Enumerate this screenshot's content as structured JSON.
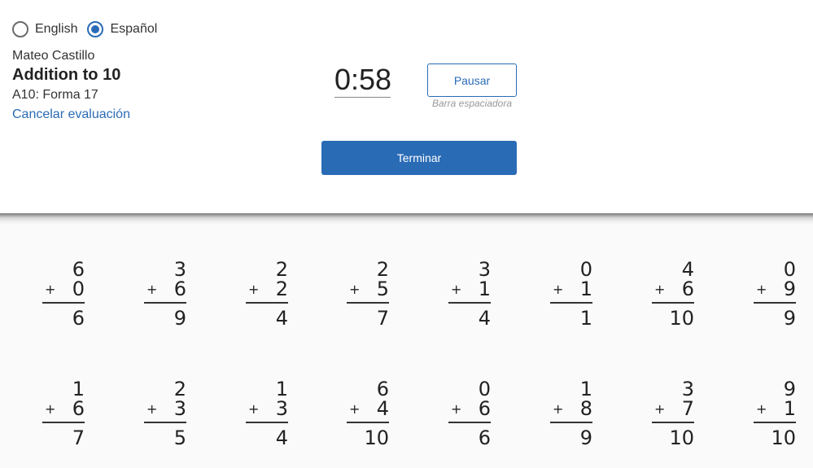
{
  "language": {
    "options": [
      {
        "label": "English",
        "selected": false
      },
      {
        "label": "Español",
        "selected": true
      }
    ]
  },
  "header": {
    "student_name": "Mateo Castillo",
    "test_title": "Addition to 10",
    "form_label": "A10: Forma 17",
    "cancel_link": "Cancelar evaluación"
  },
  "timer": {
    "display": "0:58"
  },
  "controls": {
    "pause_label": "Pausar",
    "pause_hint": "Barra espaciadora",
    "finish_label": "Terminar"
  },
  "colors": {
    "accent": "#2a6bb5",
    "panel_bg": "#ffffff",
    "page_bg": "#fafafa"
  },
  "problems": [
    {
      "a": "6",
      "op": "+",
      "b": "0",
      "answer": "6"
    },
    {
      "a": "3",
      "op": "+",
      "b": "6",
      "answer": "9"
    },
    {
      "a": "2",
      "op": "+",
      "b": "2",
      "answer": "4"
    },
    {
      "a": "2",
      "op": "+",
      "b": "5",
      "answer": "7"
    },
    {
      "a": "3",
      "op": "+",
      "b": "1",
      "answer": "4"
    },
    {
      "a": "0",
      "op": "+",
      "b": "1",
      "answer": "1"
    },
    {
      "a": "4",
      "op": "+",
      "b": "6",
      "answer": "10"
    },
    {
      "a": "0",
      "op": "+",
      "b": "9",
      "answer": "9"
    },
    {
      "a": "1",
      "op": "+",
      "b": "6",
      "answer": "7"
    },
    {
      "a": "2",
      "op": "+",
      "b": "3",
      "answer": "5"
    },
    {
      "a": "1",
      "op": "+",
      "b": "3",
      "answer": "4"
    },
    {
      "a": "6",
      "op": "+",
      "b": "4",
      "answer": "10"
    },
    {
      "a": "0",
      "op": "+",
      "b": "6",
      "answer": "6"
    },
    {
      "a": "1",
      "op": "+",
      "b": "8",
      "answer": "9"
    },
    {
      "a": "3",
      "op": "+",
      "b": "7",
      "answer": "10"
    },
    {
      "a": "9",
      "op": "+",
      "b": "1",
      "answer": "10"
    }
  ]
}
